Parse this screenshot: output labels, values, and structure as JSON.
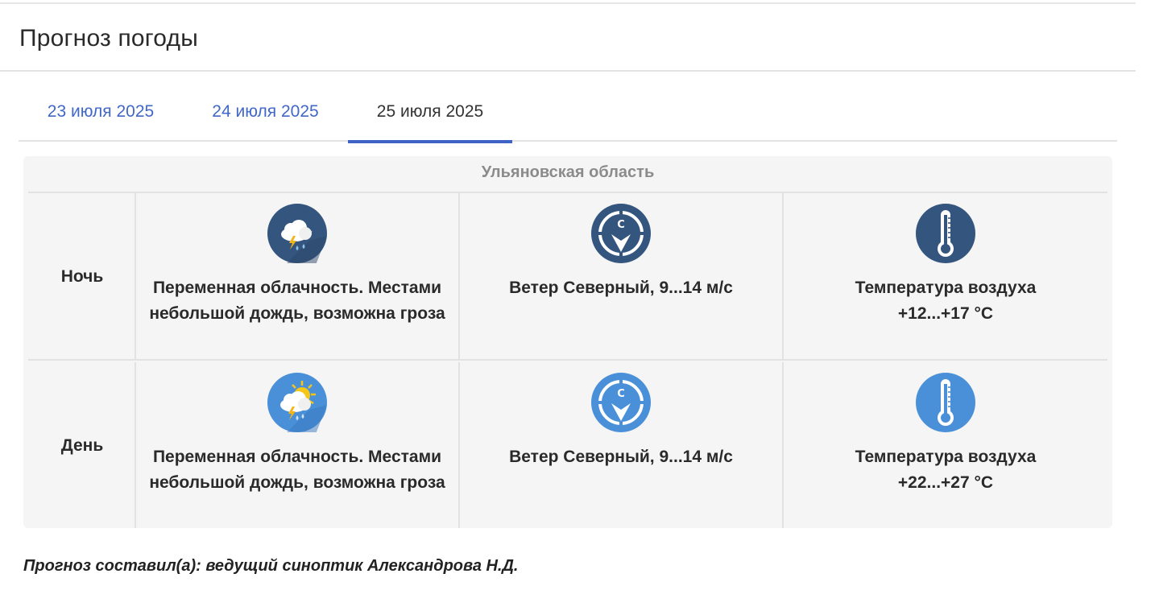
{
  "page": {
    "title": "Прогноз погоды"
  },
  "tabs": [
    {
      "label": "23 июля 2025",
      "active": false
    },
    {
      "label": "24 июля 2025",
      "active": false
    },
    {
      "label": "25 июля 2025",
      "active": true
    }
  ],
  "forecast": {
    "region": "Ульяновская область",
    "rows": [
      {
        "period": "Ночь",
        "weather": {
          "icon": "cloud-moon-thunderstorm-rain-icon",
          "text": "Переменная облачность. Местами небольшой дождь, возможна гроза"
        },
        "wind": {
          "icon": "wind-north-icon",
          "text": "Ветер Северный, 9...14 м/с"
        },
        "temperature": {
          "icon": "thermometer-icon",
          "text_line1": "Температура воздуха",
          "text_line2": "+12...+17 °C"
        }
      },
      {
        "period": "День",
        "weather": {
          "icon": "cloud-sun-thunderstorm-rain-icon",
          "text": "Переменная облачность. Местами небольшой дождь, возможна гроза"
        },
        "wind": {
          "icon": "wind-north-icon",
          "text": "Ветер Северный, 9...14 м/с"
        },
        "temperature": {
          "icon": "thermometer-icon",
          "text_line1": "Температура воздуха",
          "text_line2": "+22...+27 °C"
        }
      }
    ]
  },
  "footer": {
    "author": "Прогноз составил(а): ведущий синоптик Александрова Н.Д."
  },
  "colors": {
    "accent": "#3f63c4",
    "tab_link": "#4168c8",
    "night_icon": "#34557e",
    "day_icon": "#4a90d9",
    "card_bg": "#f5f5f5"
  }
}
